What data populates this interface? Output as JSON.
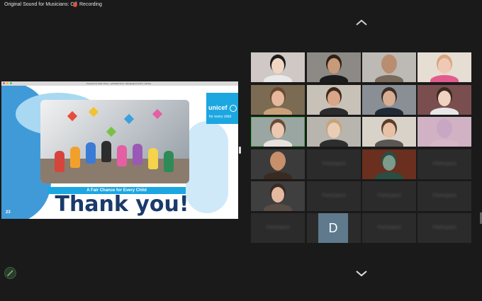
{
  "topbar": {
    "sound_toggle": "Original Sound for Musicians: Off",
    "recording_label": "Recording",
    "recording_color": "#e8493f"
  },
  "shared_screen": {
    "window_title": "PowerPoint Slide Show - [UNICEF ECS - Bangladesh SUPT_FINAL]",
    "slide": {
      "brand": "unicef",
      "brand_tagline": "for every child",
      "banner_text": "A Fair Chance for Every Child",
      "headline": "Thank you!",
      "page_number": "23",
      "brand_color": "#1ca7e1",
      "headline_color": "#1a3a6b"
    }
  },
  "gallery": {
    "tiles": [
      {
        "type": "video",
        "skin": "#f2d6c4",
        "hair": "#1b1b1b",
        "shirt": "#e9e9e9",
        "bg": "#cfc8c4"
      },
      {
        "type": "video",
        "skin": "#c99a78",
        "hair": "#2c2018",
        "shirt": "#1c1c1c",
        "bg": "#8d8a86"
      },
      {
        "type": "video",
        "skin": "#b98d6f",
        "hair": "#b98d6f",
        "shirt": "#7a6a5c",
        "bg": "#bdb9b4"
      },
      {
        "type": "video",
        "skin": "#f0c9b6",
        "hair": "#d7a77e",
        "shirt": "#e35b8d",
        "bg": "#e6ddd3"
      },
      {
        "type": "video",
        "skin": "#e6b89d",
        "hair": "#6b4a32",
        "shirt": "#caa178",
        "bg": "#7a6b52"
      },
      {
        "type": "video",
        "skin": "#d9a688",
        "hair": "#3d2a1e",
        "shirt": "#2b2b2b",
        "bg": "#c8c1b7"
      },
      {
        "type": "video",
        "skin": "#d7ae93",
        "hair": "#3a2c22",
        "shirt": "#1f2a36",
        "bg": "#8a8f95"
      },
      {
        "type": "video",
        "skin": "#efd2c2",
        "hair": "#3b2a20",
        "shirt": "#e7e7e7",
        "bg": "#7a4d4f"
      },
      {
        "type": "video",
        "skin": "#ecc8b1",
        "hair": "#6a4b36",
        "shirt": "#e8e3de",
        "bg": "#9aa6a2",
        "active": true
      },
      {
        "type": "video",
        "skin": "#e9cdb7",
        "hair": "#c8a37a",
        "shirt": "#2e2e2e",
        "bg": "#b8b4ae"
      },
      {
        "type": "video",
        "skin": "#e6c1a6",
        "hair": "#5b3b2a",
        "shirt": "#5a5654",
        "bg": "#d8d2c9"
      },
      {
        "type": "video",
        "skin": "#c9a6c4",
        "hair": "#c9a6c4",
        "shirt": "#d7b6c8",
        "bg": "#d0b2c4"
      },
      {
        "type": "video",
        "skin": "#c88f6b",
        "hair": "#c88f6b",
        "shirt": "#3b2a20",
        "bg": "#3b3b3b"
      },
      {
        "type": "name",
        "name": "Participant"
      },
      {
        "type": "video",
        "skin": "#7d9b8a",
        "hair": "#2a4d44",
        "shirt": "#2a4d44",
        "bg": "#6a2f1e"
      },
      {
        "type": "name",
        "name": "Participant"
      },
      {
        "type": "video",
        "skin": "#e4b9a0",
        "hair": "#3a2a22",
        "shirt": "#5a4d46",
        "bg": "#3f3f3f"
      },
      {
        "type": "name",
        "name": "Participant"
      },
      {
        "type": "name",
        "name": "Participant"
      },
      {
        "type": "name",
        "name": "Participant"
      },
      {
        "type": "name",
        "name": "Participant"
      },
      {
        "type": "avatar",
        "initial": "D",
        "color": "#5e7a8c"
      },
      {
        "type": "name",
        "name": "Participant"
      },
      {
        "type": "name",
        "name": "Participant"
      }
    ]
  }
}
